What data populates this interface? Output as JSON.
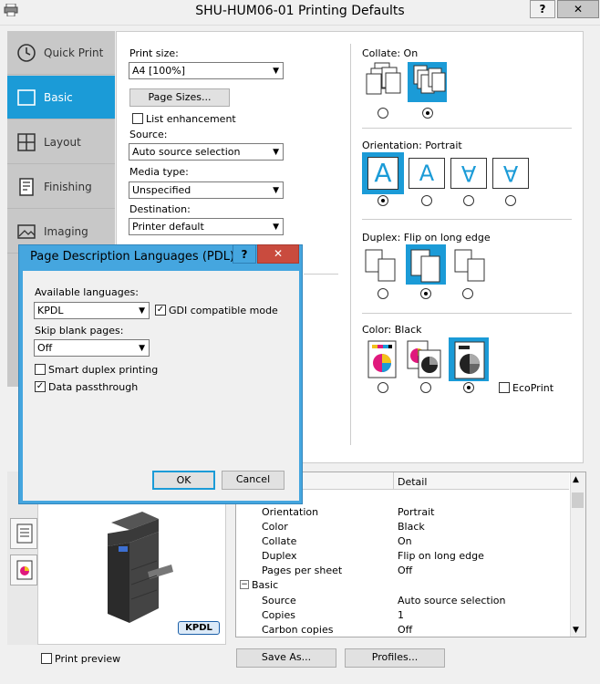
{
  "window": {
    "title": "SHU-HUM06-01 Printing Defaults",
    "help_label": "?",
    "close_label": "✕"
  },
  "sidebar": {
    "items": [
      {
        "label": "Quick Print",
        "icon": "clock-icon"
      },
      {
        "label": "Basic",
        "icon": "basic-icon"
      },
      {
        "label": "Layout",
        "icon": "layout-grid-icon"
      },
      {
        "label": "Finishing",
        "icon": "finishing-icon"
      },
      {
        "label": "Imaging",
        "icon": "image-icon"
      }
    ],
    "active": "Basic"
  },
  "basic": {
    "print_size_label": "Print size:",
    "print_size_value": "A4  [100%]",
    "page_sizes_button": "Page Sizes...",
    "list_enhancement_label": "List enhancement",
    "source_label": "Source:",
    "source_value": "Auto source selection",
    "media_type_label": "Media type:",
    "media_type_value": "Unspecified",
    "destination_label": "Destination:",
    "destination_value": "Printer default",
    "collate_label": "Collate:  On",
    "orientation_label": "Orientation:  Portrait",
    "duplex_label": "Duplex:  Flip on long edge",
    "color_label": "Color:  Black",
    "ecoprint_label": "EcoPrint",
    "orientation_glyph": "A",
    "collate_glyph_1": "1",
    "collate_glyph_2": "2",
    "collate_glyph_3": "3"
  },
  "dialog": {
    "title": "Page Description Languages (PDL)",
    "help_label": "?",
    "close_label": "✕",
    "available_languages_label": "Available languages:",
    "available_languages_value": "KPDL",
    "gdi_label": "GDI compatible mode",
    "skip_blank_label": "Skip blank pages:",
    "skip_blank_value": "Off",
    "smart_duplex_label": "Smart duplex printing",
    "data_passthrough_label": "Data passthrough",
    "ok_button": "OK",
    "cancel_button": "Cancel"
  },
  "preview": {
    "badge": "KPDL",
    "print_preview_label": "Print preview"
  },
  "settings_grid": {
    "detail_header": "Detail",
    "rows": [
      {
        "name": "Orientation",
        "value": "Portrait"
      },
      {
        "name": "Color",
        "value": "Black"
      },
      {
        "name": "Collate",
        "value": "On"
      },
      {
        "name": "Duplex",
        "value": "Flip on long edge"
      },
      {
        "name": "Pages per sheet",
        "value": "Off"
      }
    ],
    "group": "Basic",
    "group_rows": [
      {
        "name": "Source",
        "value": "Auto source selection"
      },
      {
        "name": "Copies",
        "value": "1"
      },
      {
        "name": "Carbon copies",
        "value": "Off"
      }
    ]
  },
  "footer": {
    "save_as_button": "Save As...",
    "profiles_button": "Profiles..."
  },
  "colors": {
    "accent": "#1b9bd7",
    "dialog_frame": "#45a6df",
    "close_red": "#c94b3e"
  }
}
